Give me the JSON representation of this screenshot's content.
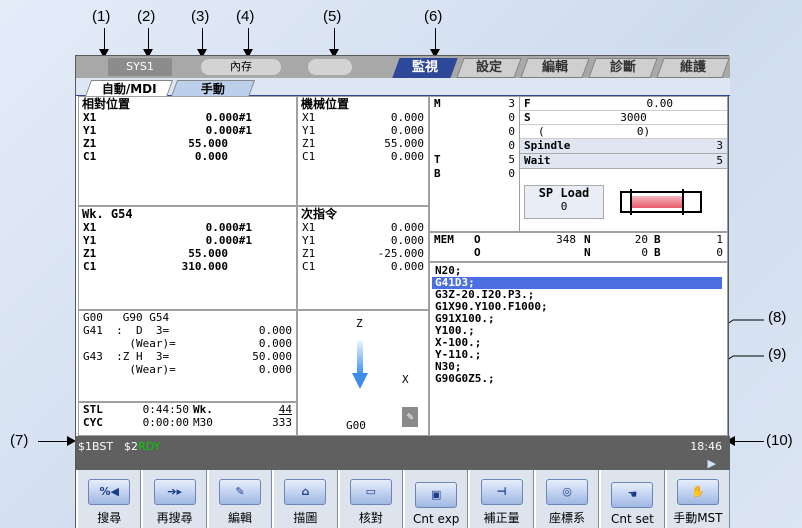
{
  "callouts": {
    "c1": "(1)",
    "c2": "(2)",
    "c3": "(3)",
    "c4": "(4)",
    "c5": "(5)",
    "c6": "(6)",
    "c7": "(7)",
    "c8": "(8)",
    "c9": "(9)",
    "c10": "(10)"
  },
  "topbar": {
    "system": "SYS1",
    "memory": "內存",
    "tabs": [
      "監視",
      "設定",
      "編輯",
      "診斷",
      "維護"
    ]
  },
  "subtabs": [
    "自動/MDI",
    "手動"
  ],
  "relative": {
    "title": "相對位置",
    "rows": [
      {
        "axis": "X1",
        "value": "0.000#1"
      },
      {
        "axis": "Y1",
        "value": "0.000#1"
      },
      {
        "axis": "Z1",
        "value": "55.000"
      },
      {
        "axis": "C1",
        "value": "0.000"
      }
    ]
  },
  "machine": {
    "title": "機械位置",
    "rows": [
      {
        "axis": "X1",
        "value": "0.000"
      },
      {
        "axis": "Y1",
        "value": "0.000"
      },
      {
        "axis": "Z1",
        "value": "55.000"
      },
      {
        "axis": "C1",
        "value": "0.000"
      }
    ]
  },
  "work": {
    "title": "Wk. G54",
    "rows": [
      {
        "axis": "X1",
        "value": "0.000#1"
      },
      {
        "axis": "Y1",
        "value": "0.000#1"
      },
      {
        "axis": "Z1",
        "value": "55.000"
      },
      {
        "axis": "C1",
        "value": "310.000"
      }
    ]
  },
  "next": {
    "title": "次指令",
    "rows": [
      {
        "axis": "X1",
        "value": "0.000"
      },
      {
        "axis": "Y1",
        "value": "0.000"
      },
      {
        "axis": "Z1",
        "value": "-25.000"
      },
      {
        "axis": "C1",
        "value": "0.000"
      }
    ]
  },
  "modal": {
    "line1": "G00   G90 G54",
    "r2l": "G41  :  D  3=",
    "r2v": "0.000",
    "r3l": "       (Wear)=",
    "r3v": "0.000",
    "r4l": "G43  :Z H  3=",
    "r4v": "50.000",
    "r5l": "       (Wear)=",
    "r5v": "0.000"
  },
  "times": {
    "stl_label": "STL",
    "stl_value": "0:44:50",
    "wk_label": "Wk.",
    "wk_value": "44",
    "cyc_label": "CYC",
    "cyc_value": "0:00:00",
    "m30_label": "M30",
    "m30_value": "333"
  },
  "axisview": {
    "z": "Z",
    "x": "X",
    "code": "G00"
  },
  "mstb": {
    "m_label": "M",
    "m_values": [
      "3",
      "0",
      "0",
      "0"
    ],
    "t_label": "T",
    "t_value": "5",
    "b_label": "B",
    "b_value": "0",
    "f_label": "F",
    "f_value": "0.00",
    "s_label": "S",
    "s_value": "3000",
    "paren_open": "(",
    "paren_value": "0)",
    "spindle_label": "Spindle",
    "spindle_value": "3",
    "wait_label": "Wait",
    "wait_value": "5",
    "spload_label": "SP Load",
    "spload_value": "0"
  },
  "mem": {
    "label": "MEM",
    "o1": "O",
    "v1": "348",
    "n1": "N",
    "nv1": "20",
    "b1": "B",
    "bv1": "1",
    "o2": "O",
    "n2": "N",
    "nv2": "0",
    "b2": "B",
    "bv2": "0"
  },
  "program": {
    "lines": [
      "N20;",
      "G41D3;",
      "G3Z-20.I20.P3.;",
      "G1X90.Y100.F1000;",
      "G91X100.;",
      "Y100.;",
      "X-100.;",
      "Y-110.;",
      "N30;",
      "G90G0Z5.;"
    ],
    "highlight": 1
  },
  "status": {
    "left": "$1BST",
    "mid": "$2",
    "rdy": "RDY",
    "time": "18:46"
  },
  "fkeys": [
    {
      "icon": "search-icon",
      "glyph": "%◀",
      "label": "搜尋"
    },
    {
      "icon": "research-icon",
      "glyph": "➔▸",
      "label": "再搜尋"
    },
    {
      "icon": "edit-icon",
      "glyph": "✎",
      "label": "編輯"
    },
    {
      "icon": "plot-icon",
      "glyph": "⌂",
      "label": "描圖"
    },
    {
      "icon": "check-icon",
      "glyph": "▭",
      "label": "核對"
    },
    {
      "icon": "cnt-exp-icon",
      "glyph": "▣",
      "label": "Cnt exp"
    },
    {
      "icon": "offset-icon",
      "glyph": "⊣",
      "label": "補正量"
    },
    {
      "icon": "coordinate-icon",
      "glyph": "◎",
      "label": "座標系"
    },
    {
      "icon": "cnt-set-icon",
      "glyph": "☚",
      "label": "Cnt set"
    },
    {
      "icon": "manual-mst-icon",
      "glyph": "✋",
      "label": "手動MST"
    }
  ],
  "colors": {
    "accent": "#2d4898",
    "highlight": "#4b6fe0",
    "rdy": "#00d000",
    "load_bar": "#e85a6a"
  }
}
